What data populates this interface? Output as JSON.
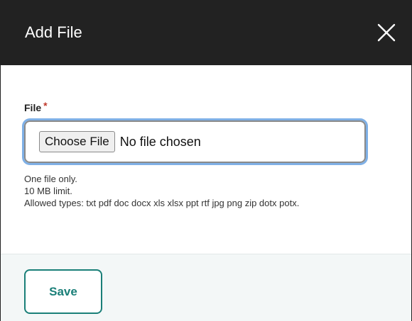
{
  "dialog": {
    "title": "Add File",
    "close_icon": "close-icon"
  },
  "field": {
    "label": "File",
    "required_marker": "*",
    "choose_button_label": "Choose File",
    "chosen_value": "No file chosen",
    "help": [
      "One file only.",
      "10 MB limit.",
      "Allowed types: txt pdf doc docx xls xlsx ppt rtf jpg png zip dotx potx."
    ]
  },
  "footer": {
    "save_label": "Save"
  },
  "colors": {
    "titlebar": "#222222",
    "accent": "#1a7f78",
    "focus_ring": "#7fb0e6",
    "required": "#c0392b",
    "footer_bg": "#f3f7f7"
  }
}
